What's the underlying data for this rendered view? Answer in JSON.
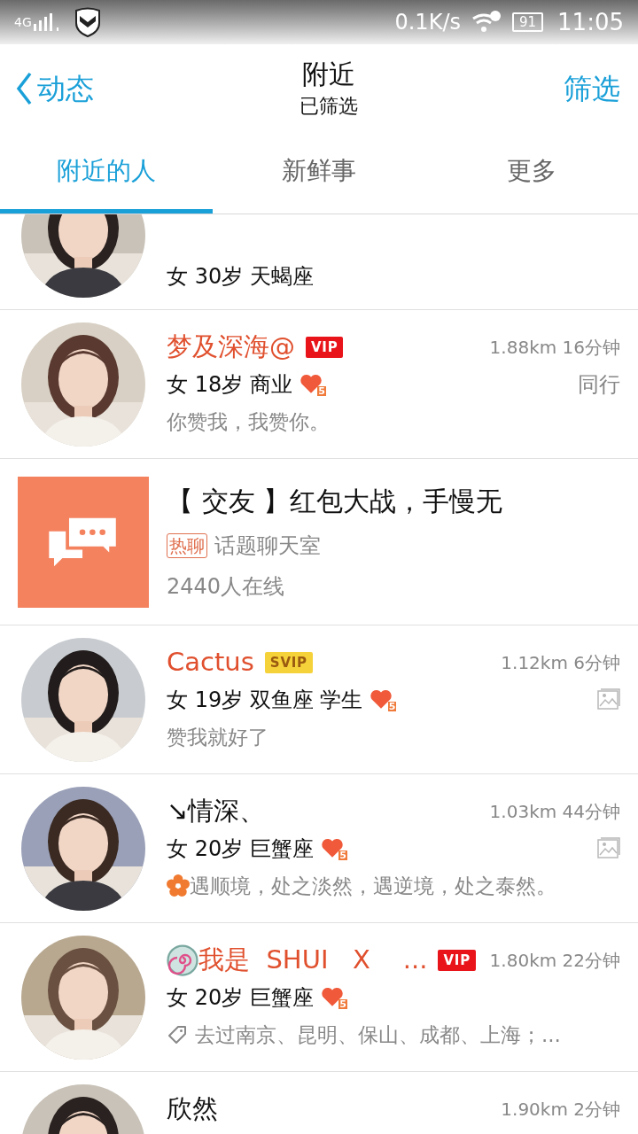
{
  "status_bar": {
    "network": "4G",
    "speed": "0.1K/s",
    "battery": "91",
    "time": "11:05"
  },
  "nav": {
    "back": "动态",
    "title": "附近",
    "subtitle": "已筛选",
    "action": "筛选"
  },
  "tabs": [
    {
      "label": "附近的人",
      "selected": true
    },
    {
      "label": "新鲜事",
      "selected": false
    },
    {
      "label": "更多",
      "selected": false
    }
  ],
  "items": [
    {
      "kind": "person",
      "info": "女 30岁 天蝎座"
    },
    {
      "kind": "person",
      "name": {
        "kind": "plain",
        "text": "梦及深海@"
      },
      "badge": {
        "kind": "vip",
        "label": "VIP"
      },
      "distance": "1.88km 16分钟",
      "info": "女 18岁 商业",
      "heart": "5",
      "side": {
        "kind": "text",
        "label": "同行"
      },
      "status": {
        "kind": "plain",
        "text": "你赞我，我赞你。"
      }
    },
    {
      "kind": "chatroom",
      "title": "【 交友 】红包大战，手慢无",
      "tag": "热聊",
      "category": "话题聊天室",
      "online": "2440人在线"
    },
    {
      "kind": "person",
      "name": {
        "kind": "plain",
        "text": "Cactus"
      },
      "badge": {
        "kind": "svip",
        "label": "SVIP"
      },
      "distance": "1.12km 6分钟",
      "info": "女 19岁 双鱼座 学生",
      "heart": "5",
      "status": {
        "kind": "plain",
        "text": "赞我就好了"
      }
    },
    {
      "kind": "person",
      "name": {
        "kind": "plain",
        "text": "↘情深、"
      },
      "distance": "1.03km 44分钟",
      "info": "女 20岁 巨蟹座",
      "heart": "5",
      "status": {
        "kind": "flower",
        "text": "遇顺境，处之淡然，遇逆境，处之泰然。"
      }
    },
    {
      "kind": "person",
      "name": {
        "kind": "swirl",
        "text": "我是  SHUI   X    ..."
      },
      "badge": {
        "kind": "vip",
        "label": "VIP"
      },
      "distance": "1.80km 22分钟",
      "info": "女 20岁 巨蟹座",
      "heart": "5",
      "status": {
        "kind": "tag",
        "text": "去过南京、昆明、保山、成都、上海；..."
      }
    },
    {
      "kind": "person",
      "name": {
        "kind": "plain",
        "text": "欣然"
      },
      "distance": "1.90km 2分钟"
    }
  ]
}
